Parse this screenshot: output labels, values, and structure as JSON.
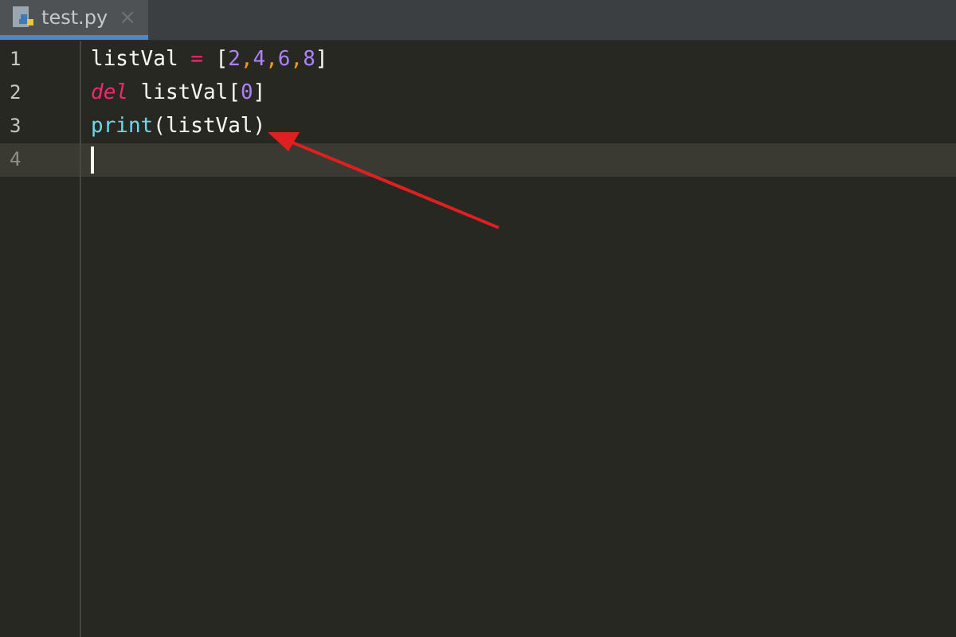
{
  "tabs": [
    {
      "label": "test.py",
      "close": "×",
      "selected": true
    }
  ],
  "lines": [
    {
      "number": "1",
      "current": false,
      "tokens": [
        {
          "kind": "name",
          "text": "listVal"
        },
        {
          "kind": "op",
          "text": " = "
        },
        {
          "kind": "punc",
          "text": "["
        },
        {
          "kind": "num",
          "text": "2"
        },
        {
          "kind": "comma",
          "text": ","
        },
        {
          "kind": "num",
          "text": "4"
        },
        {
          "kind": "comma",
          "text": ","
        },
        {
          "kind": "num",
          "text": "6"
        },
        {
          "kind": "comma",
          "text": ","
        },
        {
          "kind": "num",
          "text": "8"
        },
        {
          "kind": "punc",
          "text": "]"
        }
      ]
    },
    {
      "number": "2",
      "current": false,
      "tokens": [
        {
          "kind": "keyword",
          "text": "del "
        },
        {
          "kind": "name",
          "text": "listVal"
        },
        {
          "kind": "punc",
          "text": "["
        },
        {
          "kind": "num",
          "text": "0"
        },
        {
          "kind": "punc",
          "text": "]"
        }
      ]
    },
    {
      "number": "3",
      "current": false,
      "tokens": [
        {
          "kind": "builtin",
          "text": "print"
        },
        {
          "kind": "punc",
          "text": "("
        },
        {
          "kind": "name",
          "text": "listVal"
        },
        {
          "kind": "punc",
          "text": ")"
        }
      ]
    },
    {
      "number": "4",
      "current": true
    }
  ]
}
